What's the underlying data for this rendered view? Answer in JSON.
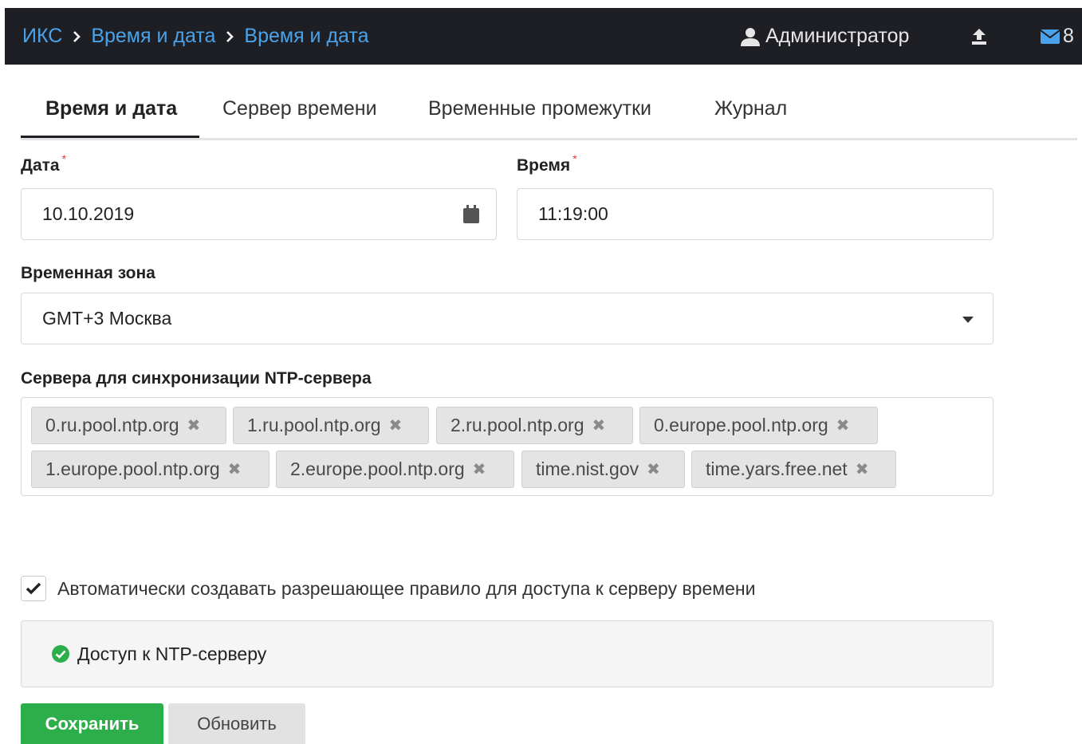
{
  "breadcrumb": {
    "items": [
      "ИКС",
      "Время и дата",
      "Время и дата"
    ]
  },
  "header": {
    "user_label": "Администратор",
    "mail_count": "8",
    "icons": {
      "user": "user-icon",
      "upload": "upload-icon",
      "mail": "envelope-icon"
    }
  },
  "tabs": [
    {
      "label": "Время и дата",
      "active": true
    },
    {
      "label": "Сервер времени",
      "active": false
    },
    {
      "label": "Временные промежутки",
      "active": false
    },
    {
      "label": "Журнал",
      "active": false
    }
  ],
  "form": {
    "date": {
      "label": "Дата",
      "required_mark": "*",
      "value": "10.10.2019"
    },
    "time": {
      "label": "Время",
      "required_mark": "*",
      "value": "11:19:00"
    },
    "timezone": {
      "label": "Временная зона",
      "value": "GMT+3 Москва"
    },
    "ntp_servers": {
      "label": "Сервера для синхронизации NTP-сервера",
      "remove_glyph": "✖",
      "tags": [
        "0.ru.pool.ntp.org",
        "1.ru.pool.ntp.org",
        "2.ru.pool.ntp.org",
        "0.europe.pool.ntp.org",
        "1.europe.pool.ntp.org",
        "2.europe.pool.ntp.org",
        "time.nist.gov",
        "time.yars.free.net"
      ]
    },
    "auto_rule": {
      "label": "Автоматически создавать разрешающее правило для доступа к серверу времени",
      "checked": true
    },
    "rule_item": {
      "label": "Доступ к NTP-серверу",
      "status_color": "#2cae4b"
    }
  },
  "buttons": {
    "save": "Сохранить",
    "refresh": "Обновить"
  },
  "colors": {
    "topbar": "#1d1f24",
    "link": "#4aa3ea",
    "save": "#2cae4b",
    "required": "#e03a3a"
  }
}
